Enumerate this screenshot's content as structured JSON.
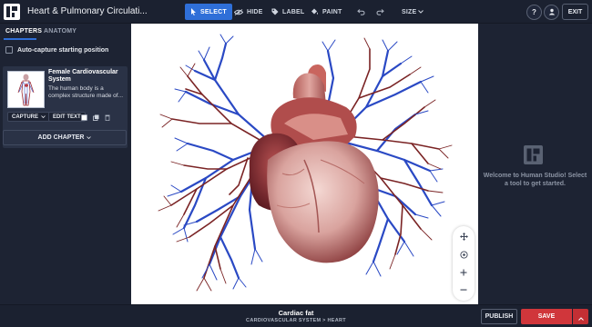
{
  "app": {
    "title": "Heart & Pulmonary Circulati..."
  },
  "toolbar": {
    "tools": [
      {
        "label": "SELECT",
        "icon": "cursor-icon",
        "active": true
      },
      {
        "label": "HIDE",
        "icon": "eye-off-icon",
        "active": false
      },
      {
        "label": "LABEL",
        "icon": "tag-icon",
        "active": false
      },
      {
        "label": "PAINT",
        "icon": "paint-bucket-icon",
        "active": false
      }
    ],
    "undo_icon": "undo-icon",
    "redo_icon": "redo-icon",
    "size_label": "SIZE",
    "help_label": "?",
    "exit_label": "EXIT"
  },
  "sidebar": {
    "tabs": [
      {
        "label": "CHAPTERS",
        "active": true
      },
      {
        "label": "ANATOMY",
        "active": false
      }
    ],
    "autocapture_label": "Auto-capture starting position",
    "chapter": {
      "title": "Female Cardiovascular System",
      "description": "The human body is a complex structure made of...",
      "capture_label": "CAPTURE",
      "edit_text_label": "EDIT TEXT"
    },
    "add_chapter_label": "ADD CHAPTER"
  },
  "right_panel": {
    "welcome_text": "Welcome to Human Studio! Select a tool to get started."
  },
  "status": {
    "selected_name": "Cardiac fat",
    "selected_path": "CARDIOVASCULAR SYSTEM > HEART"
  },
  "actions": {
    "publish_label": "PUBLISH",
    "save_label": "SAVE"
  },
  "colors": {
    "accent": "#2f6fd8",
    "save": "#d0363b",
    "background": "#1d2333",
    "viewer": "#ffffff"
  }
}
